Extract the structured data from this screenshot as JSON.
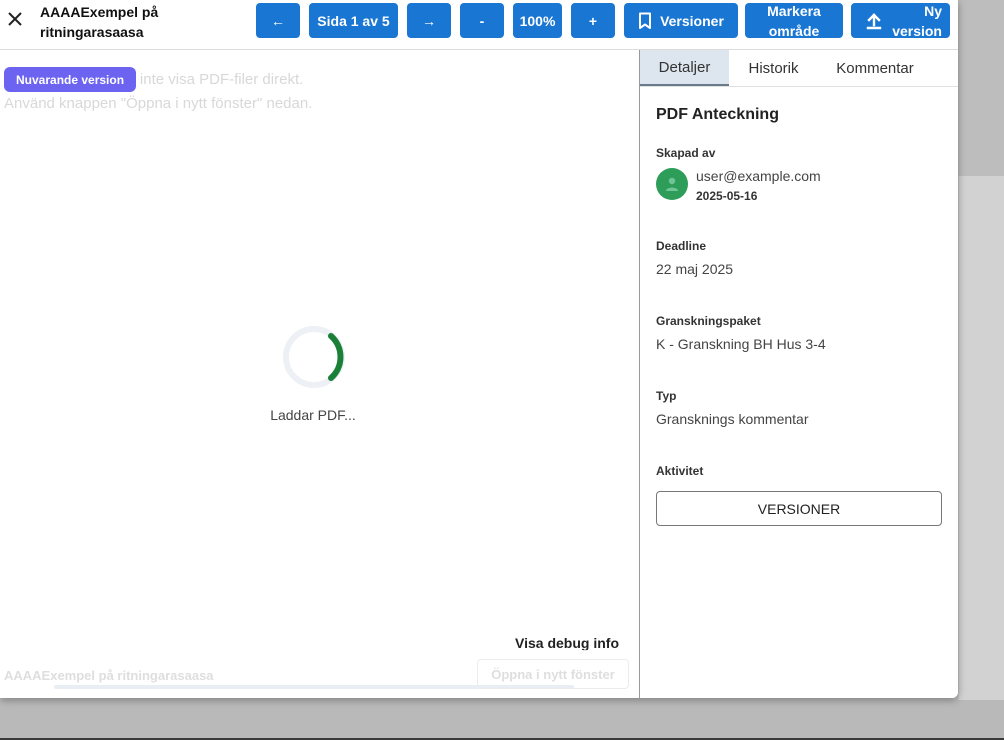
{
  "toolbar": {
    "title": "AAAAExempel på ritningarasaasa",
    "prev_page": "←",
    "page_indicator": "Sida 1 av 5",
    "next_page": "→",
    "zoom_out": "-",
    "zoom_level": "100%",
    "zoom_in": "+",
    "versions": "Versioner",
    "mark_area": "Markera område",
    "new_version": "Ny version",
    "accent": "#1976d2"
  },
  "viewer": {
    "version_badge": "Nuvarande version",
    "unsupported_line1": "Din webbläsare kan inte visa PDF-filer direkt.",
    "unsupported_line2": "Använd knappen \"Öppna i nytt fönster\" nedan.",
    "loading_text": "Laddar PDF...",
    "debug_link": "Visa debug info",
    "footer_name": "AAAAExempel på ritningarasaasa",
    "footer_open": "Öppna i nytt fönster",
    "spinner_color": "#1a7f37"
  },
  "side": {
    "tabs": [
      "Detaljer",
      "Historik",
      "Kommentar"
    ],
    "active_tab": 0,
    "heading": "PDF Anteckning",
    "created_by_label": "Skapad av",
    "created_by_email": "user@example.com",
    "created_date": "2025-05-16",
    "deadline_label": "Deadline",
    "deadline_value": "22 maj 2025",
    "package_label": "Granskningspaket",
    "package_value": "K - Granskning BH Hus 3-4",
    "type_label": "Typ",
    "type_value": "Gransknings kommentar",
    "activity_label": "Aktivitet",
    "versions_button": "VERSIONER",
    "avatar_color": "#2e9d5a"
  }
}
